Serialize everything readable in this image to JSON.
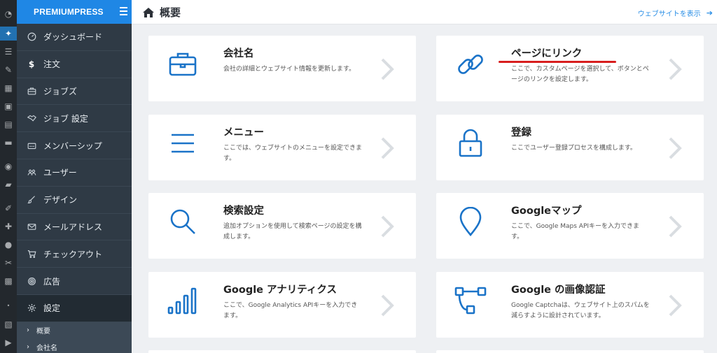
{
  "wp_sidebar": {
    "icons": [
      "dashboard-icon",
      "plugin-nav-icon",
      "posts-icon",
      "pin-icon",
      "grid-icon",
      "media-icon",
      "pages-icon",
      "comments-icon",
      "elementor-icon",
      "folder-icon",
      "appearance-icon",
      "plugins-icon",
      "users-icon",
      "tools-icon",
      "settings-icon",
      "dot-icon",
      "translate-icon",
      "play-icon"
    ]
  },
  "sidebar": {
    "brand": "PREMIUMPRESS",
    "items": [
      {
        "label": "ダッシュボード",
        "icon": "dashboard-gauge-icon"
      },
      {
        "label": "注文",
        "icon": "dollar-icon"
      },
      {
        "label": "ジョブズ",
        "icon": "briefcase-icon"
      },
      {
        "label": "ジョブ 設定",
        "icon": "handshake-icon"
      },
      {
        "label": "メンバーシップ",
        "icon": "membership-icon"
      },
      {
        "label": "ユーザー",
        "icon": "users-icon"
      },
      {
        "label": "デザイン",
        "icon": "brush-icon"
      },
      {
        "label": "メールアドレス",
        "icon": "envelope-icon"
      },
      {
        "label": "チェックアウト",
        "icon": "cart-icon"
      },
      {
        "label": "広告",
        "icon": "target-icon"
      },
      {
        "label": "設定",
        "icon": "gear-icon"
      }
    ],
    "submenu": [
      {
        "label": "概要"
      },
      {
        "label": "会社名"
      }
    ]
  },
  "header": {
    "title": "概要",
    "visit_link": "ウェブサイトを表示"
  },
  "cards": [
    {
      "title": "会社名",
      "desc": "会社の詳細とウェブサイト情報を更新します。",
      "icon": "briefcase-icon"
    },
    {
      "title": "ページにリンク",
      "desc": "ここで、カスタムページを選択して、ボタンとページのリンクを設定します。",
      "icon": "link-icon"
    },
    {
      "title": "メニュー",
      "desc": "ここでは、ウェブサイトのメニューを設定できます。",
      "icon": "menu-icon"
    },
    {
      "title": "登録",
      "desc": "ここでユーザー登録プロセスを構成します。",
      "icon": "lock-icon"
    },
    {
      "title": "検索設定",
      "desc": "追加オプションを使用して検索ページの設定を構成します。",
      "icon": "search-icon"
    },
    {
      "title": "Googleマップ",
      "desc": "ここで、Google Maps APIキーを入力できます。",
      "icon": "map-pin-icon"
    },
    {
      "title": "Google アナリティクス",
      "desc": "ここで、Google Analytics APIキーを入力できます。",
      "icon": "signal-bars-icon"
    },
    {
      "title": "Google の画像認証",
      "desc": "Google Captchaは、ウェブサイト上のスパムを減らすように設計されています。",
      "icon": "flow-icon"
    }
  ],
  "colors": {
    "accent": "#1f87e5",
    "icon_blue": "#1a73c8",
    "sidebar_bg": "#2f3a45",
    "annotation_red": "#d81e1e"
  }
}
